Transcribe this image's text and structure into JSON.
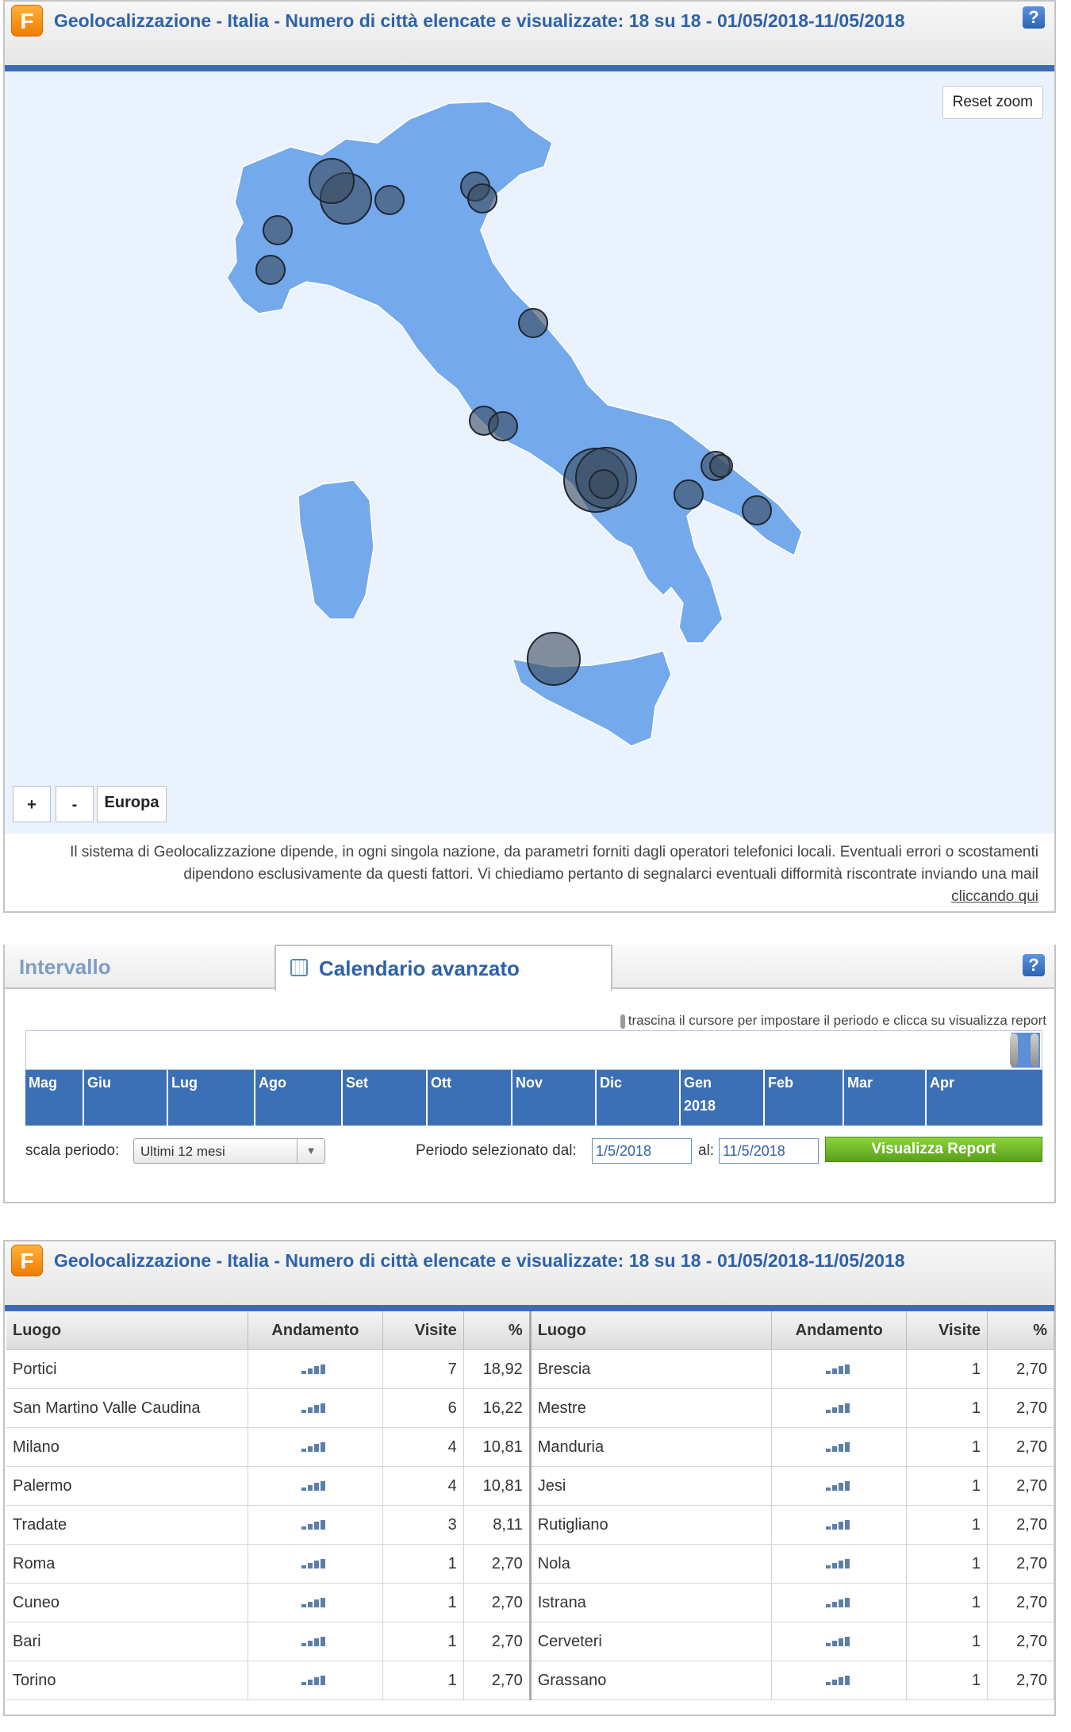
{
  "geo_panel": {
    "logo_letter": "F",
    "title": "Geolocalizzazione - Italia - Numero di città elencate e visualizzate: 18 su 18 - 01/05/2018-11/05/2018",
    "help_label": "?",
    "reset_zoom_label": "Reset zoom",
    "zoom_in_label": "+",
    "zoom_out_label": "-",
    "region_button_label": "Europa",
    "note_text": "Il sistema di Geolocalizzazione dipende, in ogni singola nazione, da parametri forniti dagli operatori telefonici locali. Eventuali errori o scostamenti dipendono esclusivamente da questi fattori. Vi chiediamo pertanto di segnalarci eventuali difformità riscontrate inviando una mail",
    "note_link": "cliccando qui"
  },
  "calendar_panel": {
    "tab_interval": "Intervallo",
    "tab_advanced": "Calendario avanzato",
    "help_label": "?",
    "timeline_hint": "trascina il cursore per impostare il periodo e clicca su visualizza report",
    "months": [
      {
        "label": "Mag",
        "year": ""
      },
      {
        "label": "Giu",
        "year": ""
      },
      {
        "label": "Lug",
        "year": ""
      },
      {
        "label": "Ago",
        "year": ""
      },
      {
        "label": "Set",
        "year": ""
      },
      {
        "label": "Ott",
        "year": ""
      },
      {
        "label": "Nov",
        "year": ""
      },
      {
        "label": "Dic",
        "year": ""
      },
      {
        "label": "Gen",
        "year": "2018"
      },
      {
        "label": "Feb",
        "year": ""
      },
      {
        "label": "Mar",
        "year": ""
      },
      {
        "label": "Apr",
        "year": ""
      }
    ],
    "scale_label": "scala periodo:",
    "scale_value": "Ultimi 12 mesi",
    "period_label": "Periodo selezionato dal:",
    "date_from": "1/5/2018",
    "to_label": "al:",
    "date_to": "11/5/2018",
    "report_button": "Visualizza Report"
  },
  "table_panel": {
    "logo_letter": "F",
    "title": "Geolocalizzazione - Italia - Numero di città elencate e visualizzate: 18 su 18 - 01/05/2018-11/05/2018",
    "headers": {
      "luogo": "Luogo",
      "andamento": "Andamento",
      "visite": "Visite",
      "pct": "%"
    },
    "left_rows": [
      {
        "luogo": "Portici",
        "visite": "7",
        "pct": "18,92"
      },
      {
        "luogo": "San Martino Valle Caudina",
        "visite": "6",
        "pct": "16,22"
      },
      {
        "luogo": "Milano",
        "visite": "4",
        "pct": "10,81"
      },
      {
        "luogo": "Palermo",
        "visite": "4",
        "pct": "10,81"
      },
      {
        "luogo": "Tradate",
        "visite": "3",
        "pct": "8,11"
      },
      {
        "luogo": "Roma",
        "visite": "1",
        "pct": "2,70"
      },
      {
        "luogo": "Cuneo",
        "visite": "1",
        "pct": "2,70"
      },
      {
        "luogo": "Bari",
        "visite": "1",
        "pct": "2,70"
      },
      {
        "luogo": "Torino",
        "visite": "1",
        "pct": "2,70"
      }
    ],
    "right_rows": [
      {
        "luogo": "Brescia",
        "visite": "1",
        "pct": "2,70"
      },
      {
        "luogo": "Mestre",
        "visite": "1",
        "pct": "2,70"
      },
      {
        "luogo": "Manduria",
        "visite": "1",
        "pct": "2,70"
      },
      {
        "luogo": "Jesi",
        "visite": "1",
        "pct": "2,70"
      },
      {
        "luogo": "Rutigliano",
        "visite": "1",
        "pct": "2,70"
      },
      {
        "luogo": "Nola",
        "visite": "1",
        "pct": "2,70"
      },
      {
        "luogo": "Istrana",
        "visite": "1",
        "pct": "2,70"
      },
      {
        "luogo": "Cerveteri",
        "visite": "1",
        "pct": "2,70"
      },
      {
        "luogo": "Grassano",
        "visite": "1",
        "pct": "2,70"
      }
    ]
  },
  "colors": {
    "title_blue": "#2e62a8",
    "map_land": "#74a9ec",
    "map_background": "#eaf3fd",
    "bubble_fill": "#3b4a5c",
    "button_green": "#6fb826"
  },
  "icons": {
    "logo": "f-logo-icon",
    "help": "help-question-icon",
    "calendar": "calendar-icon",
    "dropdown": "chevron-down-icon",
    "trend": "bar-trend-icon"
  }
}
